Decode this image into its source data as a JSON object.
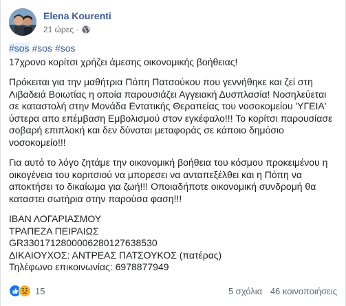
{
  "post": {
    "author": "Elena Kourenti",
    "time": "21 ώρες",
    "separator": "·",
    "hashtags": [
      "#sos",
      "#sos",
      "#sos"
    ],
    "headline": "17χρονο κορίτσι χρήζει άμεσης οικονομικής βοήθειας!",
    "paragraph1": [
      "Πρόκειται για την μαθήτρια Πόπη Πατσούκου που γεννήθηκε και ζεί στη",
      "Λιβαδειά Βοιωτίας η οποία παρουσιάζει Αγγειακή Δυσπλασία! Νοσηλεύεται",
      "σε καταστολή στην Μονάδα Εντατικής Θεραπείας του νοσοκομείου 'ΥΓΕΙΑ'",
      "ύστερα απο επέμβαση Εμβολισμού στον εγκέφαλο!!! Το κορίτσι παρουσίασε",
      "σοβαρή επιπλοκή και δεν δύναται μεταφοράς σε κάποιο δημόσιο",
      "νοσοκομείο!!!"
    ],
    "paragraph2": [
      "Για αυτό το λόγο ζητάμε την οικονομική βοήθεια του κόσμου προκειμένου η",
      "οικογένεια του κοριτσιού να μπορεσει να ανταπεξέλθει και η Πόπη να",
      "αποκτήσει το δικαίωμα για ζωή!!! Οποιαδήποτε οικονομική συνδρομή θα",
      "καταστει σωτήρια στην παρούσα φαση!!!"
    ],
    "bank_lines": [
      "ΙΒΑΝ ΛΟΓΑΡΙΑΣΜΟΥ",
      "ΤΡΑΠΕΖΑ ΠΕΙΡΑΙΩΣ",
      "GR3301712800006280127638530",
      "ΔΙΚΑΙΟΥΧΟΣ: ΑΝΤΡΕΑΣ ΠΑΤΣΟΥΚΟΣ (πατέρας)",
      "Τηλέφωνο επικοινωνίας: 6978877949"
    ]
  },
  "footer": {
    "reaction_count": "15",
    "reaction_icons": [
      "like-icon",
      "sad-icon"
    ],
    "comments": "5 σχόλια",
    "shares": "46 κοινοποιήσεις"
  },
  "colors": {
    "author_link": "#385898",
    "hashtag": "#385898",
    "like_blue": "#1877f2",
    "sad_yellow": "#f7b125",
    "meta_gray": "#616770"
  },
  "icons": {
    "privacy": "globe-icon",
    "avatar": "avatar"
  }
}
